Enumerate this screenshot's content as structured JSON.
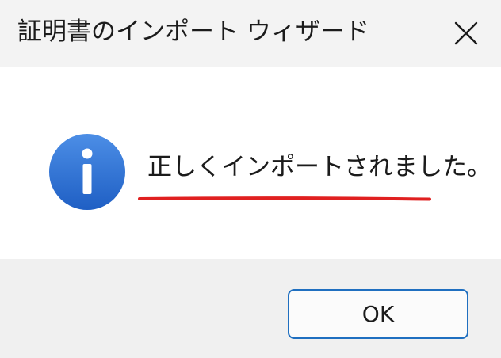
{
  "window": {
    "title": "証明書のインポート ウィザード",
    "close_icon": "close-icon"
  },
  "message": {
    "icon": "info-icon",
    "text": "正しくインポートされました。",
    "underline_color": "#e02020"
  },
  "footer": {
    "ok_label": "OK"
  },
  "colors": {
    "title_bar": "#f3f3f3",
    "footer": "#f0f0f0",
    "accent_border": "#1f6fc0",
    "info_blue": "#2a6fd6"
  }
}
